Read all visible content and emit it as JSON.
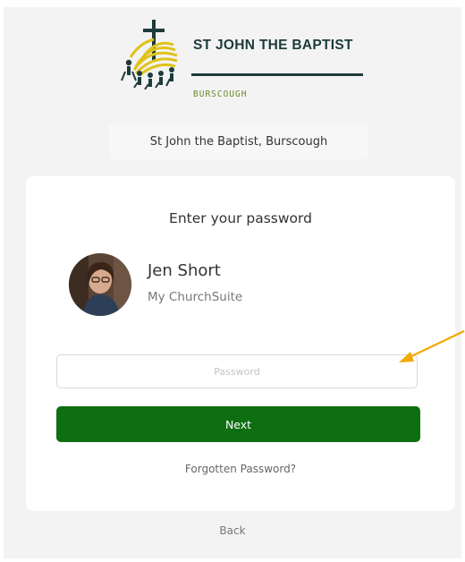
{
  "brand": {
    "title": "ST JOHN THE BAPTIST",
    "subtitle": "BURSCOUGH",
    "colors": {
      "dark": "#1d3b3a",
      "green": "#6b8a2a",
      "gold": "#e0c21a"
    }
  },
  "church": {
    "name": "St John the Baptist, Burscough"
  },
  "login": {
    "heading": "Enter your password",
    "user": {
      "name": "Jen Short",
      "account": "My ChurchSuite"
    },
    "password": {
      "placeholder": "Password",
      "value": ""
    },
    "next_label": "Next",
    "forgot_label": "Forgotten Password?",
    "back_label": "Back"
  },
  "colors": {
    "accent": "#0e6e12",
    "annotation_arrow": "#f2a900"
  }
}
